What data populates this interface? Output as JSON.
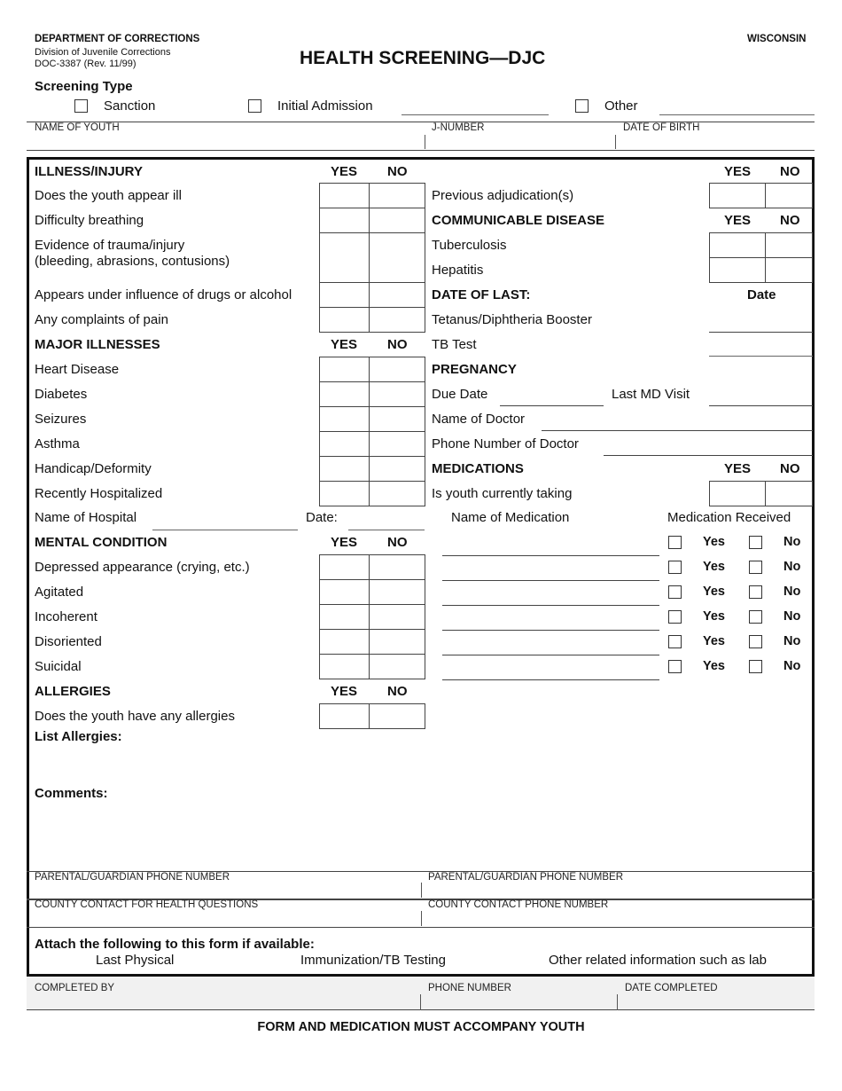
{
  "header": {
    "department": "DEPARTMENT OF CORRECTIONS",
    "division": "Division of Juvenile Corrections",
    "form_number": "DOC-3387 (Rev. 11/99)",
    "title": "HEALTH SCREENING—DJC",
    "state": "WISCONSIN"
  },
  "screening_type": {
    "label": "Screening Type",
    "options": [
      {
        "label": "Sanction",
        "checked": false
      },
      {
        "label": "Initial Admission",
        "checked": false
      },
      {
        "label": "Other",
        "checked": false
      }
    ]
  },
  "youth_fields": {
    "name_label": "NAME OF YOUTH",
    "name_value": "",
    "jnumber_label": "J-NUMBER",
    "jnumber_value": "",
    "dob_label": "DATE OF BIRTH",
    "dob_value": ""
  },
  "yes_label": "YES",
  "no_label": "NO",
  "illness_injury": {
    "title": "ILLNESS/INJURY",
    "items": [
      {
        "label": "Does the youth appear ill"
      },
      {
        "label": "Difficulty breathing"
      },
      {
        "label": "Evidence of trauma/injury",
        "label2": "(bleeding, abrasions, contusions)"
      },
      {
        "label": "Appears under influence of drugs or alcohol"
      },
      {
        "label": "Any complaints of pain"
      }
    ]
  },
  "major_illnesses": {
    "title": "MAJOR ILLNESSES",
    "items": [
      {
        "label": "Heart Disease"
      },
      {
        "label": "Diabetes"
      },
      {
        "label": "Seizures"
      },
      {
        "label": "Asthma"
      },
      {
        "label": "Handicap/Deformity"
      },
      {
        "label": "Recently Hospitalized"
      }
    ],
    "hospital_label": "Name of Hospital",
    "hospital_value": "",
    "date_label": "Date:",
    "date_value": ""
  },
  "mental_condition": {
    "title": "MENTAL CONDITION",
    "items": [
      {
        "label": "Depressed appearance (crying, etc.)"
      },
      {
        "label": "Agitated"
      },
      {
        "label": "Incoherent"
      },
      {
        "label": "Disoriented"
      },
      {
        "label": "Suicidal"
      }
    ]
  },
  "allergies": {
    "title": "ALLERGIES",
    "question": "Does the youth have any allergies",
    "list_label": "List Allergies:",
    "list_value": ""
  },
  "comments": {
    "label": "Comments:",
    "value": ""
  },
  "adjudication": {
    "label": "Previous adjudication(s)"
  },
  "communicable_disease": {
    "title": "COMMUNICABLE DISEASE",
    "items": [
      {
        "label": "Tuberculosis"
      },
      {
        "label": "Hepatitis"
      }
    ]
  },
  "date_of_last": {
    "title": "DATE OF LAST:",
    "date_header": "Date",
    "items": [
      {
        "label": "Tetanus/Diphtheria Booster",
        "value": ""
      },
      {
        "label": "TB Test",
        "value": ""
      }
    ]
  },
  "pregnancy": {
    "title": "PREGNANCY",
    "due_date_label": "Due Date",
    "due_date_value": "",
    "last_md_label": "Last MD Visit",
    "last_md_value": "",
    "doctor_label": "Name of Doctor",
    "doctor_value": "",
    "doctor_phone_label": "Phone Number of Doctor",
    "doctor_phone_value": ""
  },
  "medications": {
    "title": "MEDICATIONS",
    "question": "Is youth currently taking",
    "name_header": "Name of Medication",
    "received_header": "Medication Received",
    "yes_option": "Yes",
    "no_option": "No",
    "rows": [
      {
        "name": "",
        "received": null
      },
      {
        "name": "",
        "received": null
      },
      {
        "name": "",
        "received": null
      },
      {
        "name": "",
        "received": null
      },
      {
        "name": "",
        "received": null
      },
      {
        "name": "",
        "received": null
      }
    ]
  },
  "contacts": {
    "guardian_phone_1_label": "PARENTAL/GUARDIAN PHONE NUMBER",
    "guardian_phone_1_value": "",
    "guardian_phone_2_label": "PARENTAL/GUARDIAN PHONE NUMBER",
    "guardian_phone_2_value": "",
    "county_contact_label": "COUNTY CONTACT FOR HEALTH QUESTIONS",
    "county_contact_value": "",
    "county_phone_label": "COUNTY CONTACT PHONE NUMBER",
    "county_phone_value": ""
  },
  "attachments": {
    "title": "Attach the following to this form if available:",
    "items": [
      "Last Physical",
      "Immunization/TB Testing",
      "Other related information such as lab"
    ]
  },
  "completion": {
    "completed_by_label": "COMPLETED BY",
    "completed_by_value": "",
    "phone_label": "PHONE NUMBER",
    "phone_value": "",
    "date_label": "DATE COMPLETED",
    "date_value": ""
  },
  "footer": {
    "notice": "FORM AND MEDICATION MUST ACCOMPANY YOUTH"
  }
}
